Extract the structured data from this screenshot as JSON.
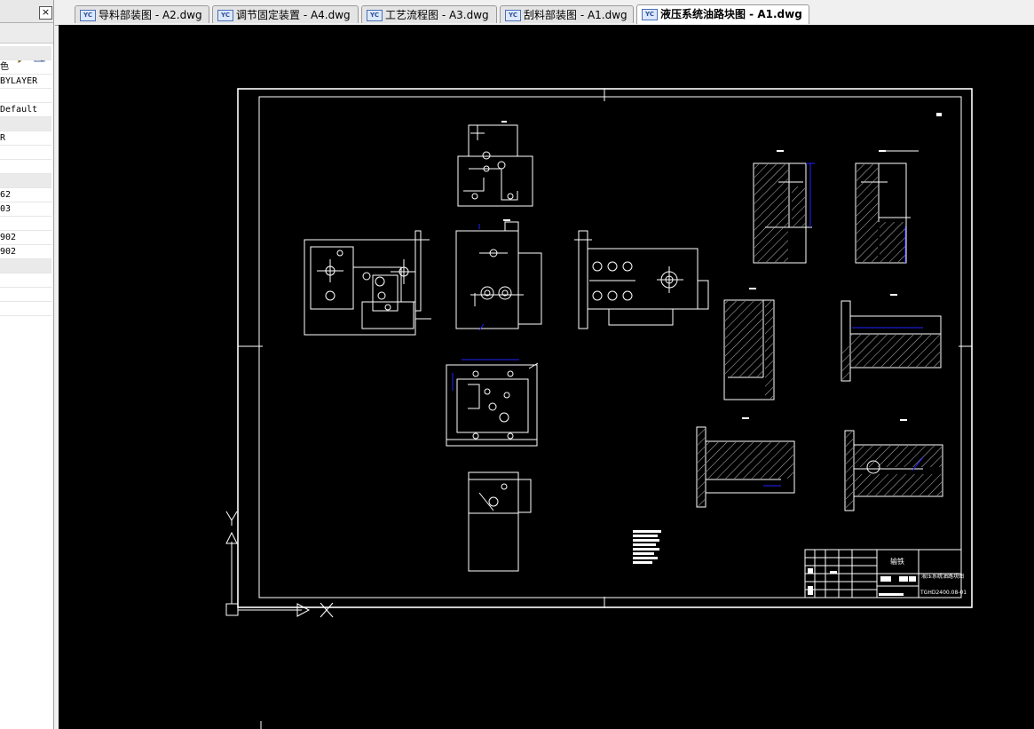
{
  "panel": {
    "close_label": "×",
    "tool_dropdown": "▾",
    "rows": [
      {
        "text": "",
        "section": true
      },
      {
        "text": "色",
        "section": false
      },
      {
        "text": " BYLAYER",
        "section": false
      },
      {
        "text": "",
        "section": false
      },
      {
        "text": " Default",
        "section": false
      },
      {
        "text": "",
        "section": true
      },
      {
        "text": "R",
        "section": false
      },
      {
        "text": "",
        "section": false
      },
      {
        "text": "",
        "section": false
      },
      {
        "text": "",
        "section": true
      },
      {
        "text": "62",
        "section": false
      },
      {
        "text": "03",
        "section": false
      },
      {
        "text": "",
        "section": false
      },
      {
        "text": "902",
        "section": false
      },
      {
        "text": "902",
        "section": false
      },
      {
        "text": "",
        "section": true
      },
      {
        "text": "",
        "section": false
      },
      {
        "text": "",
        "section": false
      },
      {
        "text": "",
        "section": false
      }
    ]
  },
  "tabs": [
    {
      "label": "导料部装图 - A2.dwg",
      "icon": "dwg-file-icon",
      "active": false
    },
    {
      "label": "调节固定装置 - A4.dwg",
      "icon": "dwg-file-icon",
      "active": false
    },
    {
      "label": "工艺流程图 - A3.dwg",
      "icon": "dwg-file-icon",
      "active": false
    },
    {
      "label": "刮料部装图 - A1.dwg",
      "icon": "dwg-file-icon",
      "active": false
    },
    {
      "label": "液压系统油路块图 - A1.dwg",
      "icon": "dwg-file-icon",
      "active": true
    }
  ],
  "tab_icon_text": "YC",
  "drawing": {
    "title_company": "输铁",
    "title_name": "液压系统油路块图",
    "title_code": "TGHD2400.08-01",
    "ucs_y": "Y",
    "ucs_x": "X"
  },
  "colors": {
    "background": "#000000",
    "lines": "#ffffff",
    "dims": "#2222ff"
  }
}
